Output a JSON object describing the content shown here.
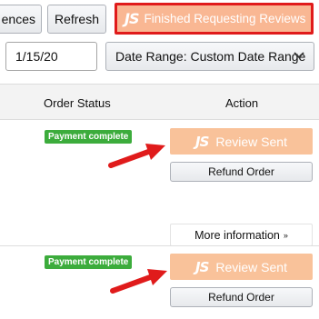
{
  "toolbar": {
    "preferences_label": "ences",
    "refresh_label": "Refresh",
    "finished_logo": "JS",
    "finished_label": "Finished Requesting Reviews",
    "highlight_color": "#e01b1b"
  },
  "filters": {
    "date_value": "1/15/20",
    "date_range_label": "Date Range: Custom Date Range"
  },
  "table": {
    "columns": [
      "Order Status",
      "Action"
    ]
  },
  "rows": [
    {
      "status_badge": "Payment complete",
      "review_logo": "JS",
      "review_label": "Review Sent",
      "refund_label": "Refund Order"
    },
    {
      "more_info_label": "More information",
      "status_badge": "Payment complete",
      "review_logo": "JS",
      "review_label": "Review Sent",
      "refund_label": "Refund Order"
    }
  ],
  "colors": {
    "badge_green": "#3cac3c",
    "review_orange": "#f9c29a",
    "arrow_red": "#e01b1b"
  }
}
